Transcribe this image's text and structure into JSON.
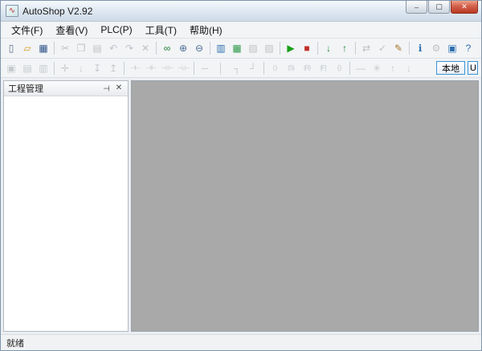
{
  "window": {
    "title": "AutoShop V2.92",
    "app_icon_glyph": "∿",
    "controls": [
      {
        "name": "minimize-button",
        "glyph": "–"
      },
      {
        "name": "maximize-button",
        "glyph": "▢"
      },
      {
        "name": "close-button",
        "glyph": "✕"
      }
    ]
  },
  "menu": {
    "items": [
      {
        "name": "menu-file",
        "label": "文件(F)"
      },
      {
        "name": "menu-view",
        "label": "查看(V)"
      },
      {
        "name": "menu-plc",
        "label": "PLC(P)"
      },
      {
        "name": "menu-tools",
        "label": "工具(T)"
      },
      {
        "name": "menu-help",
        "label": "帮助(H)"
      }
    ]
  },
  "toolbar_main": {
    "icons": [
      {
        "name": "new-file-icon",
        "glyph": "▯",
        "color": "#5b6e86",
        "enabled": true
      },
      {
        "name": "open-project-icon",
        "glyph": "▱",
        "color": "#d79a1f",
        "enabled": true
      },
      {
        "name": "save-icon",
        "glyph": "▦",
        "color": "#33568c",
        "enabled": true
      },
      {
        "type": "sep"
      },
      {
        "name": "cut-icon",
        "glyph": "✂",
        "color": "#8a8f96",
        "enabled": false
      },
      {
        "name": "copy-icon",
        "glyph": "❐",
        "color": "#8a8f96",
        "enabled": false
      },
      {
        "name": "paste-icon",
        "glyph": "▤",
        "color": "#8a8f96",
        "enabled": false
      },
      {
        "name": "undo-icon",
        "glyph": "↶",
        "color": "#7d94b5",
        "enabled": false
      },
      {
        "name": "redo-icon",
        "glyph": "↷",
        "color": "#7d94b5",
        "enabled": false
      },
      {
        "name": "delete-icon",
        "glyph": "✕",
        "color": "#8a8f96",
        "enabled": false
      },
      {
        "type": "sep"
      },
      {
        "name": "find-binoculars-icon",
        "glyph": "∞",
        "color": "#1e7e35",
        "enabled": true
      },
      {
        "name": "zoom-in-icon",
        "glyph": "⊕",
        "color": "#4a6c94",
        "enabled": true
      },
      {
        "name": "zoom-out-icon",
        "glyph": "⊖",
        "color": "#4a6c94",
        "enabled": true
      },
      {
        "type": "sep"
      },
      {
        "name": "project-window-icon",
        "glyph": "▥",
        "color": "#2e6fb0",
        "enabled": true
      },
      {
        "name": "ladder-monitor-icon",
        "glyph": "▦",
        "color": "#2f9a4b",
        "enabled": true
      },
      {
        "name": "data-monitor-icon",
        "glyph": "▧",
        "color": "#8a8f96",
        "enabled": false
      },
      {
        "name": "element-monitor-icon",
        "glyph": "▨",
        "color": "#8a8f96",
        "enabled": false
      },
      {
        "type": "sep"
      },
      {
        "name": "run-icon",
        "glyph": "▶",
        "color": "#18a018",
        "enabled": true
      },
      {
        "name": "stop-icon",
        "glyph": "■",
        "color": "#c03028",
        "enabled": true
      },
      {
        "type": "sep"
      },
      {
        "name": "download-to-plc-icon",
        "glyph": "↓",
        "color": "#1d8a3a",
        "enabled": true
      },
      {
        "name": "upload-from-plc-icon",
        "glyph": "↑",
        "color": "#1d8a3a",
        "enabled": true
      },
      {
        "type": "sep"
      },
      {
        "name": "convert-icon",
        "glyph": "⇄",
        "color": "#8a8f96",
        "enabled": false
      },
      {
        "name": "check-program-icon",
        "glyph": "✓",
        "color": "#8a8f96",
        "enabled": false
      },
      {
        "name": "edit-data-icon",
        "glyph": "✎",
        "color": "#a8762a",
        "enabled": true
      },
      {
        "type": "sep"
      },
      {
        "name": "plc-info-icon",
        "glyph": "ℹ",
        "color": "#2e6fb0",
        "enabled": true
      },
      {
        "name": "settings-icon",
        "glyph": "⚙",
        "color": "#8a8f96",
        "enabled": false
      },
      {
        "name": "comm-config-icon",
        "glyph": "▣",
        "color": "#2e6fb0",
        "enabled": true
      },
      {
        "name": "help-icon",
        "glyph": "?",
        "color": "#2e6fb0",
        "enabled": true
      }
    ]
  },
  "toolbar_ladder": {
    "icons": [
      {
        "name": "select-tool-icon",
        "glyph": "▣",
        "enabled": false
      },
      {
        "name": "network-comment-icon",
        "glyph": "▤",
        "enabled": false
      },
      {
        "name": "instruction-list-icon",
        "glyph": "▥",
        "enabled": false
      },
      {
        "type": "sep"
      },
      {
        "name": "insert-network-icon",
        "glyph": "✛",
        "enabled": false
      },
      {
        "name": "append-network-icon",
        "glyph": "↓",
        "enabled": false
      },
      {
        "name": "insert-row-icon",
        "glyph": "↧",
        "enabled": false
      },
      {
        "name": "delete-row-icon",
        "glyph": "↥",
        "enabled": false
      },
      {
        "type": "sep"
      },
      {
        "name": "open-contact-icon",
        "glyph": "⊣⊢",
        "enabled": false
      },
      {
        "name": "closed-contact-icon",
        "glyph": "⊣/⊢",
        "enabled": false
      },
      {
        "name": "rising-edge-contact-icon",
        "glyph": "⊣↑⊢",
        "enabled": false
      },
      {
        "name": "falling-edge-contact-icon",
        "glyph": "⊣↓⊢",
        "enabled": false
      },
      {
        "type": "sep"
      },
      {
        "name": "horizontal-line-icon",
        "glyph": "─",
        "enabled": false
      },
      {
        "name": "vertical-line-icon",
        "glyph": "│",
        "enabled": false
      },
      {
        "name": "corner-line-icon",
        "glyph": "┐",
        "enabled": false
      },
      {
        "name": "branch-line-icon",
        "glyph": "┘",
        "enabled": false
      },
      {
        "type": "sep"
      },
      {
        "name": "output-coil-icon",
        "glyph": "( )",
        "enabled": false
      },
      {
        "name": "set-coil-icon",
        "glyph": "(S)",
        "enabled": false
      },
      {
        "name": "reset-coil-icon",
        "glyph": "(R)",
        "enabled": false
      },
      {
        "name": "function-block-icon",
        "glyph": "[F]",
        "enabled": false
      },
      {
        "name": "compare-block-icon",
        "glyph": "{ }",
        "enabled": false
      },
      {
        "type": "sep"
      },
      {
        "name": "delete-line-icon",
        "glyph": "—",
        "enabled": false
      },
      {
        "name": "delete-branch-icon",
        "glyph": "✳",
        "enabled": false
      },
      {
        "name": "move-up-icon",
        "glyph": "↑",
        "enabled": false
      },
      {
        "name": "move-down-icon",
        "glyph": "↓",
        "enabled": false
      }
    ],
    "mode_buttons": [
      {
        "name": "local-mode-button",
        "label": "本地",
        "clipped": false
      },
      {
        "name": "usb-mode-button",
        "label": "U",
        "clipped": true
      }
    ]
  },
  "project_panel": {
    "title": "工程管理",
    "icons": [
      {
        "name": "pin-icon",
        "glyph": "⊤",
        "rotate": 90
      },
      {
        "name": "close-panel-icon",
        "glyph": "✕",
        "rotate": 0
      }
    ]
  },
  "statusbar": {
    "text": "就绪"
  },
  "colors": {
    "workspace_gray": "#a9a9a9",
    "accent_blue": "#3a93d5",
    "run_green": "#18a018",
    "stop_red": "#c03028"
  }
}
